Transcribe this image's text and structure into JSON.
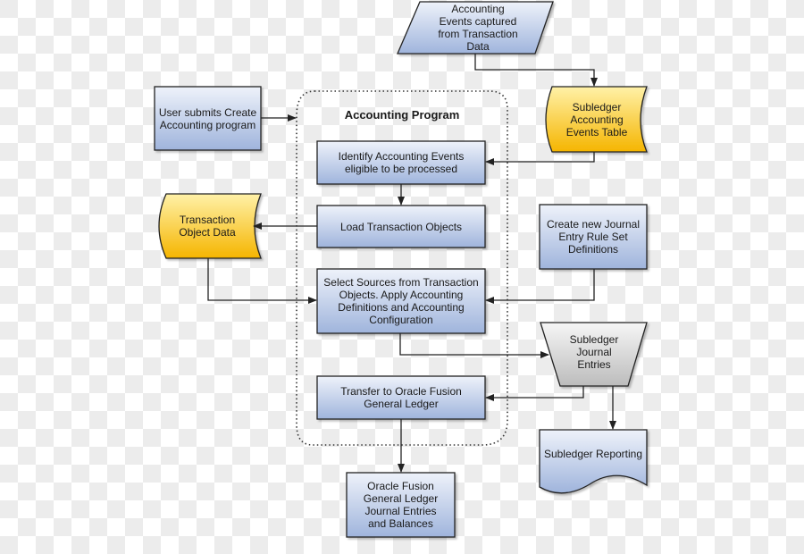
{
  "diagram": {
    "title": "Accounting Program",
    "colors": {
      "process_top": "#eef2fa",
      "process_bottom": "#9fb4dc",
      "storage_top": "#fff1a8",
      "storage_bottom": "#f5b500",
      "journal_top": "#f4f4f4",
      "journal_bottom": "#bdbdbd",
      "stroke": "#222222"
    },
    "nodes": {
      "accounting_events": "Accounting\nEvents captured\nfrom Transaction\nData",
      "subledger_events_table": "Subledger\nAccounting\nEvents Table",
      "user_submits": "User submits Create\nAccounting program",
      "identify_events": "Identify Accounting Events\neligible to be processed",
      "load_objects": "Load Transaction Objects",
      "transaction_object_data": "Transaction\nObject Data",
      "create_rule_sets": "Create new Journal\nEntry Rule Set\nDefinitions",
      "select_sources": "Select Sources from Transaction\nObjects. Apply Accounting\nDefinitions and Accounting\nConfiguration",
      "subledger_journal_entries": "Subledger\nJournal\nEntries",
      "transfer_gl": "Transfer to Oracle Fusion\nGeneral Ledger",
      "subledger_reporting": "Subledger Reporting",
      "gl_journal_entries": "Oracle Fusion\nGeneral Ledger\nJournal Entries\nand Balances"
    }
  }
}
